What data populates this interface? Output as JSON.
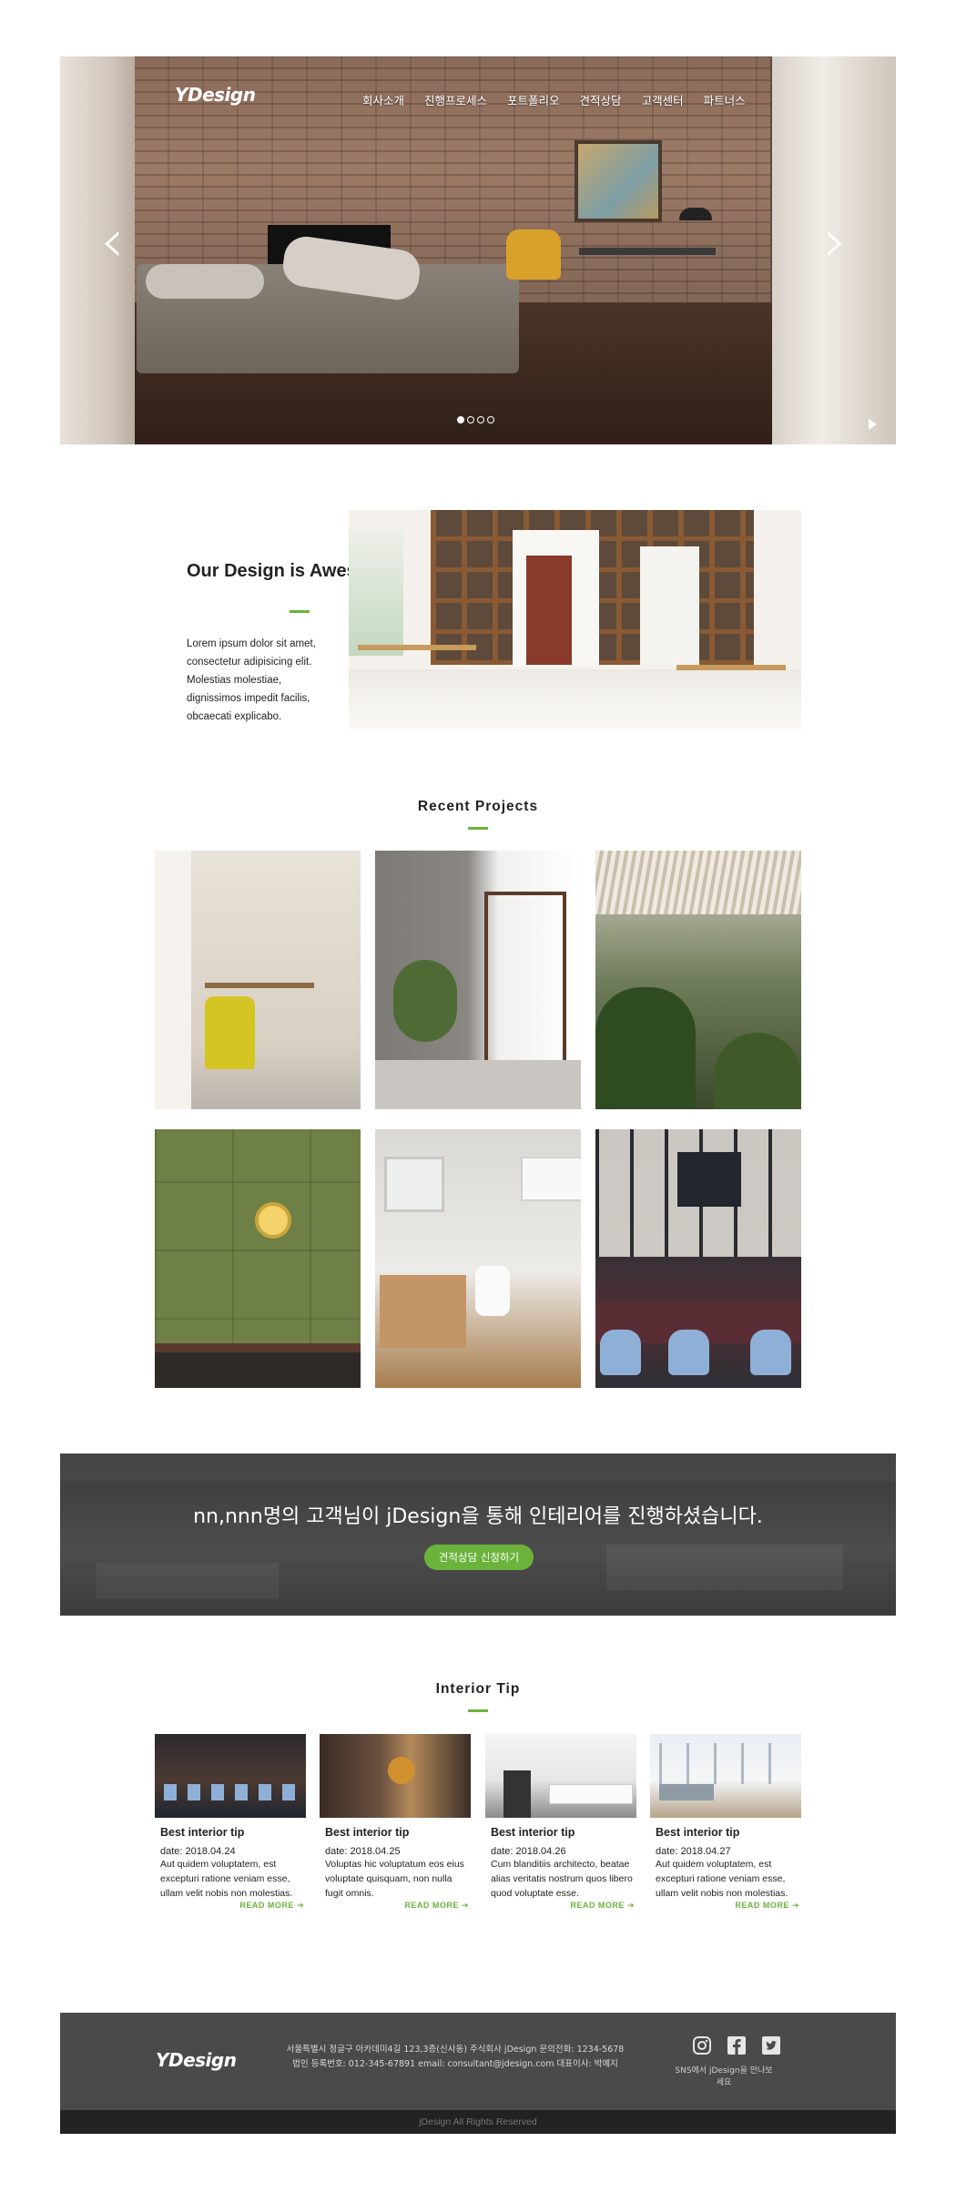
{
  "brand": {
    "logo": "YDesign",
    "accent": "#6bb33b"
  },
  "nav": {
    "items": [
      "회사소개",
      "진행프로세스",
      "포트폴리오",
      "견적상담",
      "고객센터",
      "파트너스"
    ]
  },
  "hero": {
    "slides_total": 4,
    "active_slide": 1
  },
  "about": {
    "title": "Our Design is Awesome.",
    "text": "Lorem ipsum dolor sit amet, consectetur adipisicing elit. Molestias molestiae, dignissimos impedit facilis, obcaecati explicabo."
  },
  "projects": {
    "title": "Recent Projects"
  },
  "cta": {
    "text": "nn,nnn명의 고객님이 jDesign을 통해 인테리어를 진행하셨습니다.",
    "button": "견적상담 신청하기"
  },
  "tips": {
    "title": "Interior Tip",
    "items": [
      {
        "title": "Best interior tip",
        "date": "date: 2018.04.24",
        "body": "Aut quidem voluptatem, est excepturi ratione veniam esse, ullam velit nobis non molestias.",
        "more": "READ MORE"
      },
      {
        "title": "Best interior tip",
        "date": "date: 2018.04.25",
        "body": "Voluptas hic voluptatum eos eius voluptate quisquam, non nulla fugit omnis.",
        "more": "READ MORE"
      },
      {
        "title": "Best interior tip",
        "date": "date: 2018.04.26",
        "body": "Cum blanditiis architecto, beatae alias veritatis nostrum quos libero quod voluptate esse.",
        "more": "READ MORE"
      },
      {
        "title": "Best interior tip",
        "date": "date: 2018.04.27",
        "body": "Aut quidem voluptatem, est excepturi ratione veniam esse, ullam velit nobis non molestias.",
        "more": "READ MORE"
      }
    ]
  },
  "footer": {
    "logo": "YDesign",
    "address": "서울특별시 정글구 아카데미4길 123,3층(신사동) 주식회사 jDesign 문의전화: 1234-5678",
    "business": "법인 등록번호: 012-345-67891 email: consultant@jdesign.com 대표이사: 박예지",
    "sns_label": "SNS에서 jDesign을 만나보세요",
    "sns_icons": [
      "instagram-icon",
      "facebook-icon",
      "twitter-icon"
    ],
    "copyright": "jDesign All Rights Reserved"
  }
}
